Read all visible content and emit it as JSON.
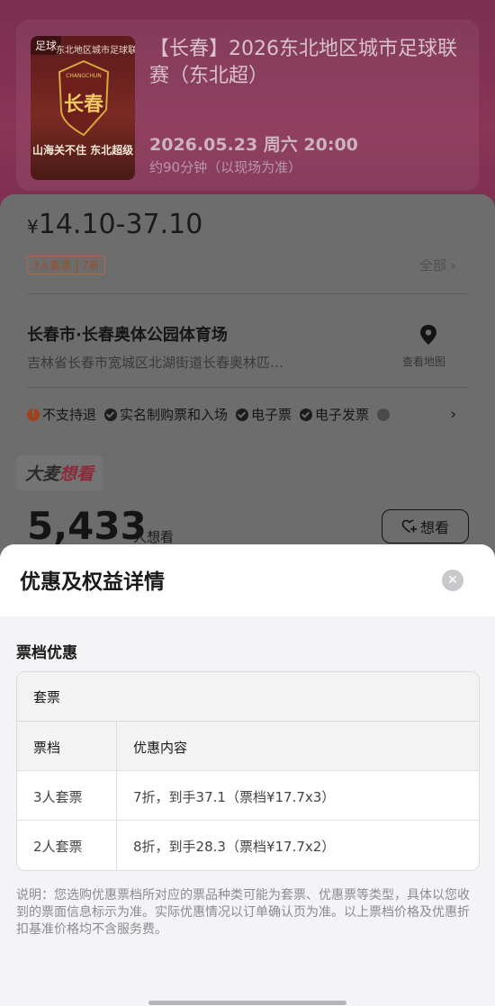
{
  "event": {
    "poster": {
      "tag": "足球",
      "top_text": "东北地区城市足球联赛",
      "crest_top": "CHANGCHUN",
      "crest_text": "长春",
      "bottom_text": "山海关不住 东北超级"
    },
    "title": "【长春】2026东北地区城市足球联赛（东北超）",
    "datetime": "2026.05.23 周六 20:00",
    "duration": "约90分钟（以现场为准）"
  },
  "pricing": {
    "currency": "¥",
    "range": "14.10-37.10",
    "promo_tag": "3人套票 | 7折",
    "all_link": "全部 ›"
  },
  "venue": {
    "name": "长春市·长春奥体公园体育场",
    "address": "吉林省长春市宽城区北湖街道长春奥林匹…",
    "map_label": "查看地图"
  },
  "policies": [
    {
      "label": "不支持退",
      "icon": "warning-icon"
    },
    {
      "label": "实名制购票和入场",
      "icon": "check-icon"
    },
    {
      "label": "电子票",
      "icon": "check-icon"
    },
    {
      "label": "电子发票",
      "icon": "check-icon"
    }
  ],
  "policy_more": "›",
  "want": {
    "logo_main": "大麦",
    "logo_sub": "想看",
    "count": "5,433",
    "unit": "人想看",
    "button_label": "想看"
  },
  "modal": {
    "title": "优惠及权益详情",
    "close_glyph": "✕",
    "section_title": "票档优惠",
    "package_header": "套票",
    "columns": [
      "票档",
      "优惠内容"
    ],
    "rows": [
      [
        "3人套票",
        "7折，到手37.1（票档¥17.7x3）"
      ],
      [
        "2人套票",
        "8折，到手28.3（票档¥17.7x2）"
      ]
    ],
    "note": "说明：您选购优惠票档所对应的票品种类可能为套票、优惠票等类型，具体以您收到的票面信息标示为准。实际优惠情况以订单确认页为准。以上票档价格及优惠折扣基准价格均不含服务费。"
  },
  "colors": {
    "hero": "#8a3456",
    "overlay": "#6d6d6d",
    "modal_bg": "#f4f4f6",
    "accent_warning": "#a0431a"
  }
}
